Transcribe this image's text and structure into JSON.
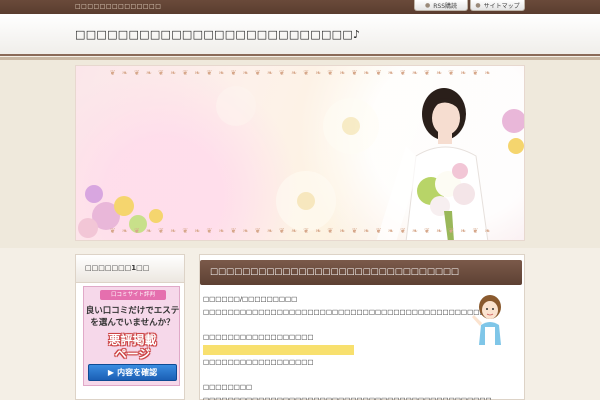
{
  "topbar": {
    "tagline": "□□□□□□□□□□□□□□",
    "rss_label": "RSS購読",
    "sitemap_label": "サイトマップ"
  },
  "header": {
    "site_title": "□□□□□□□□□□□□□□□□□□□□□□□□□□♪"
  },
  "sidebar": {
    "heading": "□□□□□□□1□□",
    "ad": {
      "tag": "口コミサイト評判",
      "line1": "良い口コミだけでエステ",
      "line2": "を選んでいませんか？",
      "big1": "悪評掲載",
      "big2": "ページ",
      "button_label": "内容を確認"
    }
  },
  "main": {
    "heading": "□□□□□□□□□□□□□□□□□□□□□□□□□□□□□□□",
    "lines": [
      "□□□□□□/□□□□□□□□□",
      "□□□□□□□□□□□□□□□□□□□□□□□□□□□□□□□□□□□□□□□□□□□□□□□",
      "□□□□□□□□□□□□□□□□□□",
      "□□□□□□□□□□□□□□□□□□",
      "□□□□□□□□",
      "□□□□□□□□□□□□□□□□□□□□□□□□□□□□□□□□□□□□□□□□□□□□□□□"
    ]
  },
  "colors": {
    "topbar": "#5a3d2f",
    "main_heading_bg": "#6b4d3e",
    "highlight": "#f8e06e",
    "ad_button": "#1b5fb5",
    "ad_bg": "#f6d8ea"
  },
  "icons": {
    "rss": "rss-icon",
    "sitemap": "sitemap-icon",
    "ad_arrow": "arrow-right-icon"
  }
}
